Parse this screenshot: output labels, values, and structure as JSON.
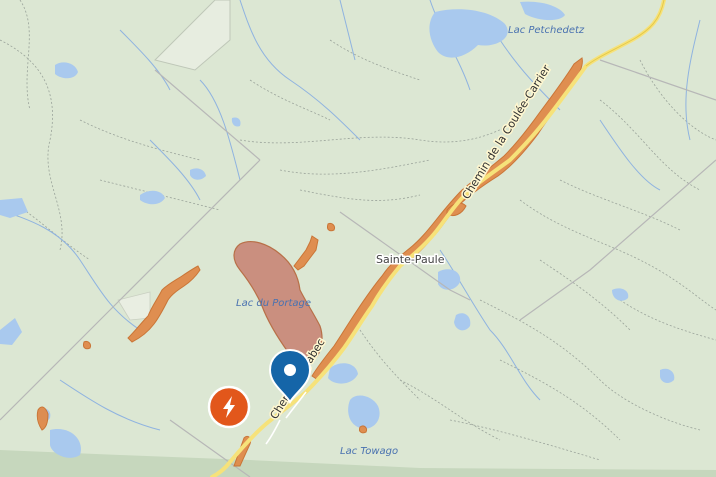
{
  "map": {
    "place_labels": {
      "lac_petchedetz": "Lac Petchedetz",
      "lac_du_portage": "Lac du Portage",
      "sainte_paule": "Sainte-Paule",
      "lac_towago": "Lac Towago"
    },
    "road_labels": {
      "chemin_coulee_carrier": "Chemin de la Coulée-Carrier",
      "chemin_sayabec": "Chemin Sayabec"
    },
    "markers": {
      "location_pin": "location-pin-icon",
      "power_outage": "lightning-bolt-icon"
    },
    "colors": {
      "land": "#dfe9d6",
      "water": "#a9c9ee",
      "water_label": "#4a72b0",
      "road_main": "#f6e27a",
      "outage_fill": "#e08a4a",
      "outage_area": "#c77a6a",
      "pin": "#1565a8",
      "outage_marker": "#e2571b"
    }
  }
}
